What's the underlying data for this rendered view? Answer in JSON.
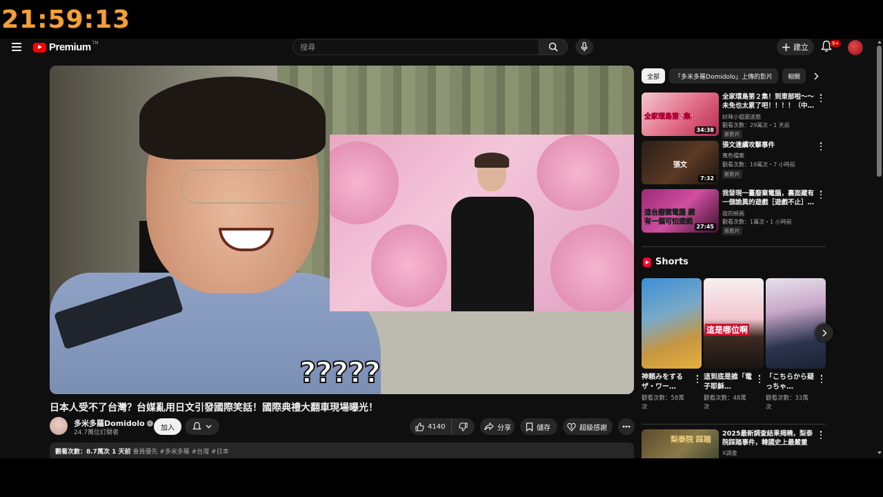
{
  "overlay_clock": "21:59:13",
  "masthead": {
    "logo_text": "Premium",
    "logo_tm": "TM",
    "search_placeholder": "搜尋",
    "create_label": "建立",
    "notification_badge": "9+"
  },
  "video": {
    "caption": "?????",
    "title": "日本人受不了台灣？台媒亂用日文引發國際笑話！國際典禮大翻車現場曝光！",
    "channel_name": "多米多羅Domidolo",
    "subscribers": "24.7萬位訂閱者",
    "join_label": "加入",
    "like_count": "4140",
    "share_label": "分享",
    "save_label": "儲存",
    "thanks_label": "超級感謝",
    "description_stats": "觀看次數：8.7萬次  1 天前",
    "description_tags": "會員優先  #多米多羅 #台灣 #日本"
  },
  "sidebar": {
    "chips": [
      "全部",
      "「多米多羅Domidolo」上傳的影片",
      "相關"
    ],
    "recommendations": [
      {
        "title": "全家環島第２集！到東部啦～～未免也太累了吧！！！！（中…",
        "channel": "好味小姐圖波筋",
        "views": "觀看次數：29萬次・1 天前",
        "badge": "新影片",
        "duration": "34:38",
        "thumb_text": "全家環島第2集!"
      },
      {
        "title": "張文連續攻擊事件",
        "channel": "寬色檔案",
        "views": "觀看次數：19萬次・7 小時前",
        "badge": "新影片",
        "duration": "7:32",
        "thumb_text": "張文"
      },
      {
        "title": "我發現一臺廢棄電腦，裏面藏有一個詭異的遊戲［遊戲不止］…",
        "channel": "寂的映画",
        "views": "觀看次數：1萬次・1 小時前",
        "badge": "新影片",
        "duration": "27:45",
        "thumb_text": "這台廢棄電腦 藏有一個可怕遊戲"
      }
    ],
    "shorts_heading": "Shorts",
    "shorts": [
      {
        "title": "神頼みをするザ・ワー…",
        "views": "觀看次數：58萬次",
        "thumb_text": ""
      },
      {
        "title": "這到底是誰「電子耶穌…",
        "views": "觀看次數：48萬次",
        "thumb_text": "這是哪位啊"
      },
      {
        "title": "「こちらから疑っちゃ…",
        "views": "觀看次數：33萬次",
        "thumb_text": ""
      }
    ],
    "bottom_rec": {
      "title": "2025最新調查結果揭曉，梨泰院踩踏事件，韓國史上最嚴重的…",
      "channel": "X調查",
      "thumb_text": "梨泰院 踩踏"
    }
  },
  "colors": {
    "background": "#0f0f0f",
    "clock": "#f2a03a",
    "brand_red": "#ff0000",
    "surface": "#272727"
  }
}
